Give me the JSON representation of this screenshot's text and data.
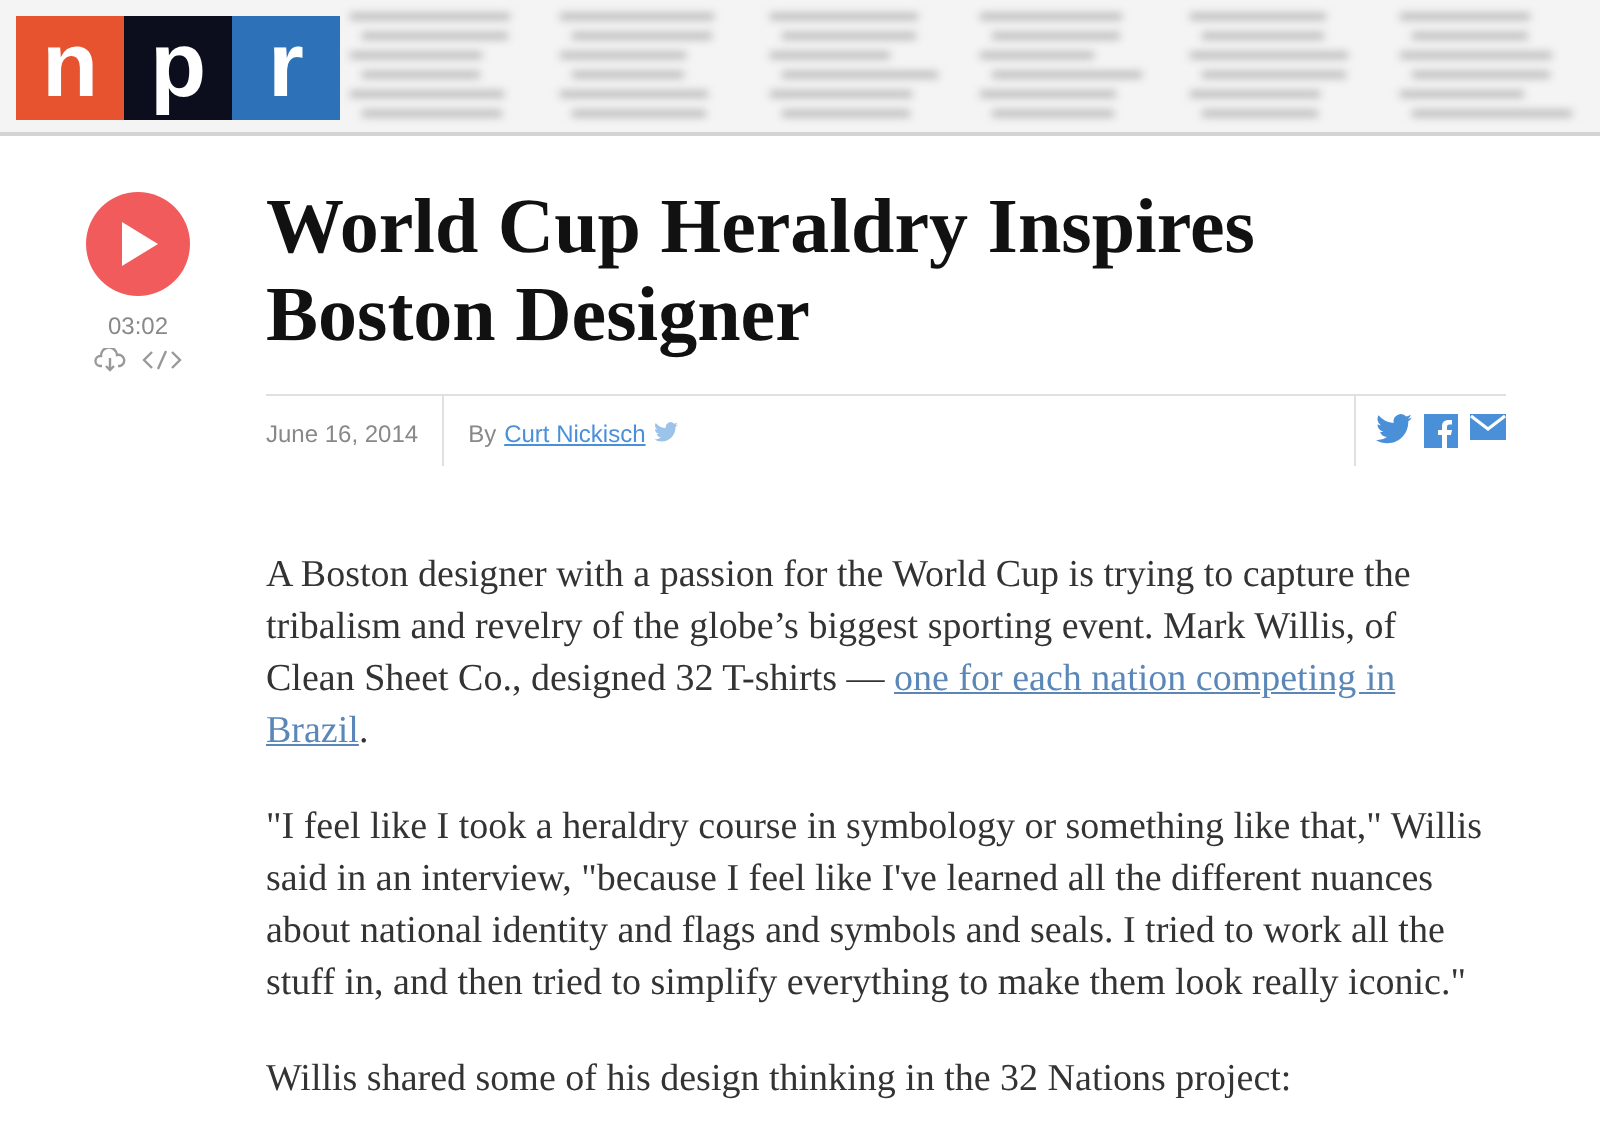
{
  "header": {
    "logo_letters": [
      "n",
      "p",
      "r"
    ]
  },
  "audio": {
    "duration": "03:02"
  },
  "article": {
    "title": "World Cup Heraldry Inspires Boston Designer",
    "date": "June 16, 2014",
    "byline_prefix": "By",
    "author": "Curt Nickisch",
    "paragraphs": [
      {
        "parts": [
          {
            "text": "A Boston designer with a passion for the World Cup is trying to capture the tribalism and revelry of the globe’s biggest sporting event. Mark Willis, of Clean Sheet Co., designed 32 T-shirts — ",
            "link": false
          },
          {
            "text": "one for each nation competing in",
            "link": true
          },
          {
            "text": "Brazil",
            "link": true
          },
          {
            "text": ".",
            "link": false
          }
        ]
      },
      {
        "parts": [
          {
            "text": "\"I feel like I took a heraldry course in symbology or something like that,\" Willis said in an interview, \"because I feel like I've learned all the different nuances about national identity and flags and symbols and seals. I tried to work all the stuff in, and then tried to simplify everything to make them look really iconic.\"",
            "link": false
          }
        ]
      },
      {
        "parts": [
          {
            "text": "Willis shared some of his design thinking in the 32 Nations project:",
            "link": false
          }
        ]
      }
    ]
  }
}
